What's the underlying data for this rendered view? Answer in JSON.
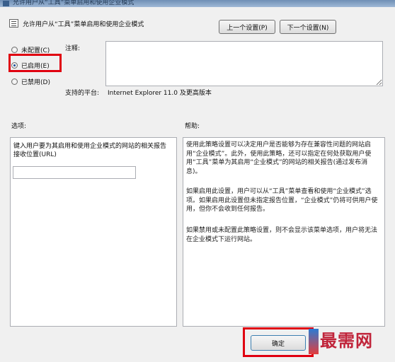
{
  "window": {
    "title": "允许用户从“工具”菜单启用和使用企业模式"
  },
  "header": {
    "policy_name": "允许用户从“工具”菜单启用和使用企业模式",
    "prev_button": "上一个设置(P)",
    "next_button": "下一个设置(N)"
  },
  "state": {
    "options": [
      {
        "label": "未配置(C)",
        "selected": false
      },
      {
        "label": "已启用(E)",
        "selected": true
      },
      {
        "label": "已禁用(D)",
        "selected": false
      }
    ]
  },
  "comment": {
    "label": "注释:",
    "value": ""
  },
  "platform": {
    "label": "支持的平台:",
    "value": "Internet Explorer 11.0 及更高版本"
  },
  "options_section": {
    "label": "选项:",
    "description": "键入用户要为其启用和使用企业模式的网站的相关报告接收位置(URL)",
    "url_value": ""
  },
  "help_section": {
    "label": "帮助:",
    "paragraphs": [
      "使用此策略设置可以决定用户是否能够为存在兼容性问题的网站启用“企业模式”。此外，使用此策略，还可以指定在何处获取用户使用“工具”菜单为其启用“企业模式”的网站的相关报告(通过发布消息)。",
      "如果启用此设置，用户可以从“工具”菜单查看和使用“企业模式”选项。如果启用此设置但未指定报告位置，“企业模式”仍将可供用户使用，但你不会收到任何报告。",
      "如果禁用或未配置此策略设置，则不会显示该菜单选项，用户将无法在企业模式下运行网站。"
    ]
  },
  "footer": {
    "ok_button": "确定"
  },
  "watermark": {
    "text": "最需网"
  },
  "colors": {
    "highlight": "#e00010",
    "watermark": "#c0243a"
  }
}
